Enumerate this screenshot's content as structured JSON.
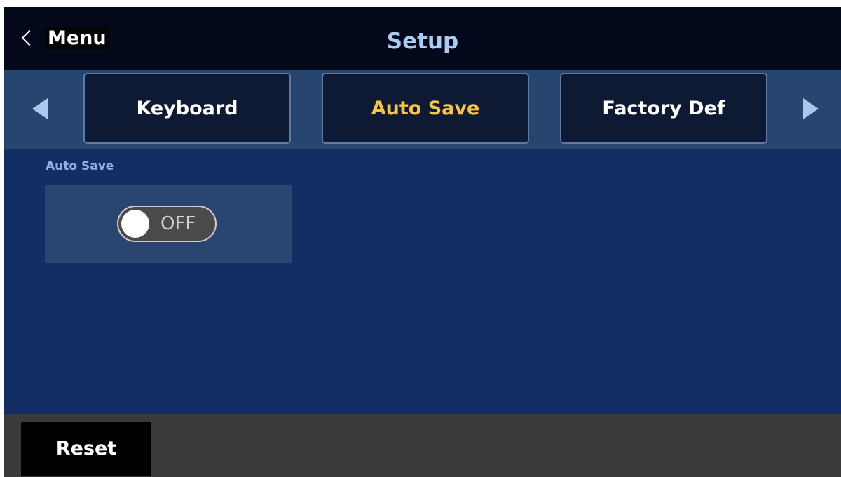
{
  "header": {
    "back_label": "Menu",
    "title": "Setup"
  },
  "tabs": [
    {
      "label": "Keyboard",
      "active": false
    },
    {
      "label": "Auto Save",
      "active": true
    },
    {
      "label": "Factory Def",
      "active": false
    }
  ],
  "auto_save": {
    "label": "Auto Save",
    "toggle_state": "OFF"
  },
  "footer": {
    "reset_label": "Reset"
  },
  "colors": {
    "header_bg": "#03091a",
    "tab_bar_bg": "#27466f",
    "content_bg": "#142e63",
    "active_tab_text": "#f6c641",
    "title_text": "#a9ccf5",
    "section_label": "#8bb1ec",
    "footer_bg": "#3a3a3a"
  },
  "icons": {
    "back": "chevron-left-icon",
    "prev": "triangle-left-icon",
    "next": "triangle-right-icon"
  }
}
